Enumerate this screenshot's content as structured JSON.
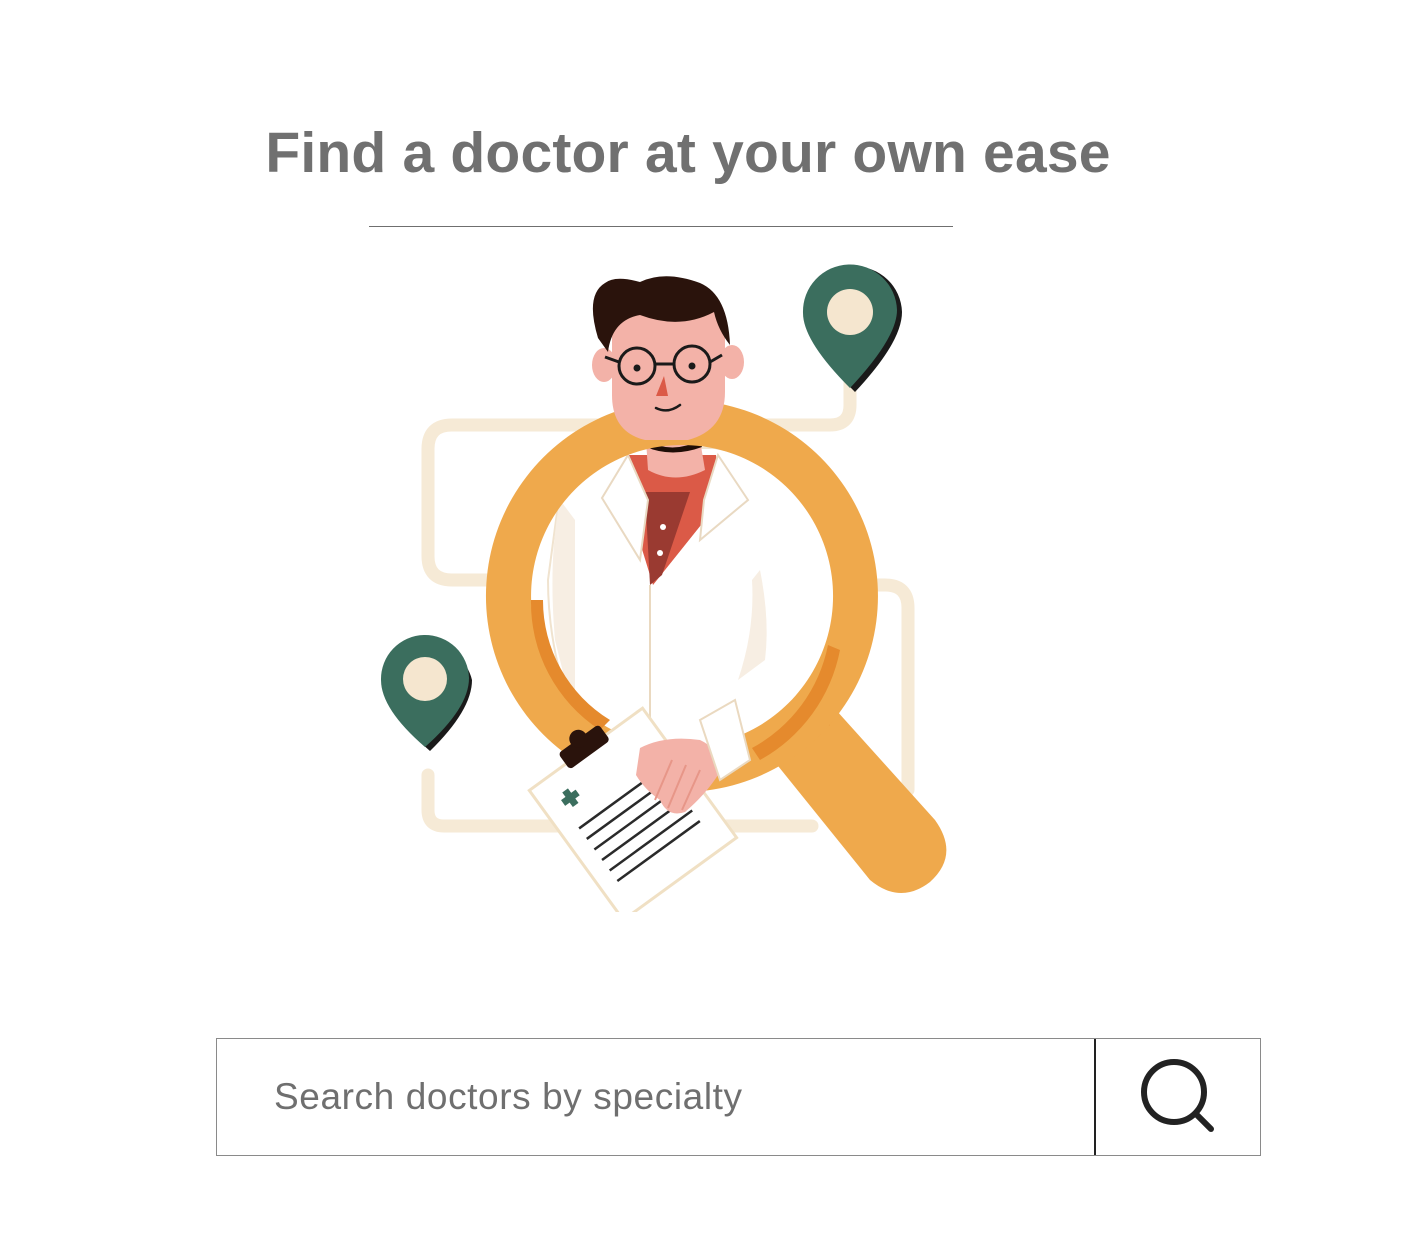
{
  "header": {
    "title": "Find a doctor at your own ease"
  },
  "hero": {
    "illustration": "doctor-with-magnifying-glass-and-location-pins"
  },
  "search": {
    "placeholder": "Search doctors by specialty",
    "value": "",
    "button_icon": "search-icon"
  },
  "colors": {
    "title_text": "#707070",
    "divider": "#6f6f6f",
    "magnifier_orange": "#efa94c",
    "pin_green": "#3b6e5e",
    "pin_cream": "#f5e6cf",
    "shirt_red": "#db5a47",
    "hair_brown": "#2a130c",
    "skin": "#f3b2a8",
    "coat_white": "#ffffff",
    "route_beige": "#f6ead6"
  }
}
